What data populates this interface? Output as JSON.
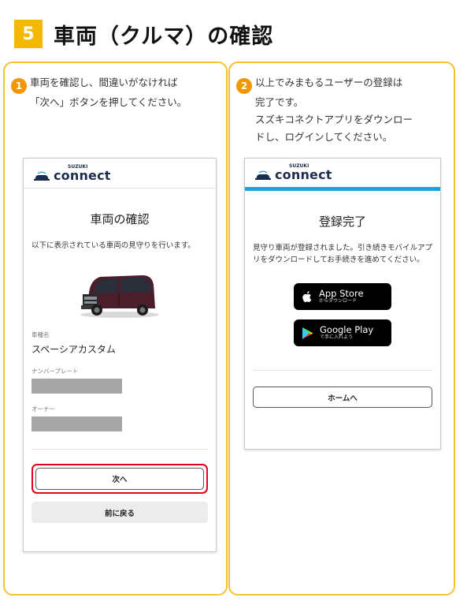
{
  "header": {
    "step_number": "5",
    "title": "車両（クルマ）の確認"
  },
  "left_panel": {
    "badge": "1",
    "instruction_lines": [
      "車両を確認し、間違いがなければ",
      "「次へ」ボタンを押してください。"
    ],
    "phone": {
      "logo_small": "SUZUKI",
      "logo_big": "connect",
      "title": "車両の確認",
      "description": "以下に表示されている車両の見守りを行います。",
      "vehicle_name_label": "車種名",
      "vehicle_name_value": "スペーシアカスタム",
      "plate_label": "ナンバープレート",
      "owner_label": "オーナー",
      "next_button": "次へ",
      "back_button": "前に戻る"
    }
  },
  "right_panel": {
    "badge": "2",
    "instruction_lines": [
      "以上でみまもるユーザーの登録は",
      "完了です。",
      "スズキコネクトアプリをダウンロー",
      "ドし、ログインしてください。"
    ],
    "phone": {
      "logo_small": "SUZUKI",
      "logo_big": "connect",
      "title": "登録完了",
      "description": "見守り車両が登録されました。引き続きモバイルアプリをダウンロードしてお手続きを進めてください。",
      "app_store_main": "App Store",
      "app_store_sub": "からダウンロード",
      "google_play_main": "Google Play",
      "google_play_sub": "で手に入れよう",
      "home_button": "ホームへ"
    }
  },
  "colors": {
    "accent_yellow": "#f5b800",
    "badge_orange": "#f29600",
    "highlight_red": "#e2001a",
    "header_blue": "#1aa3dd"
  }
}
